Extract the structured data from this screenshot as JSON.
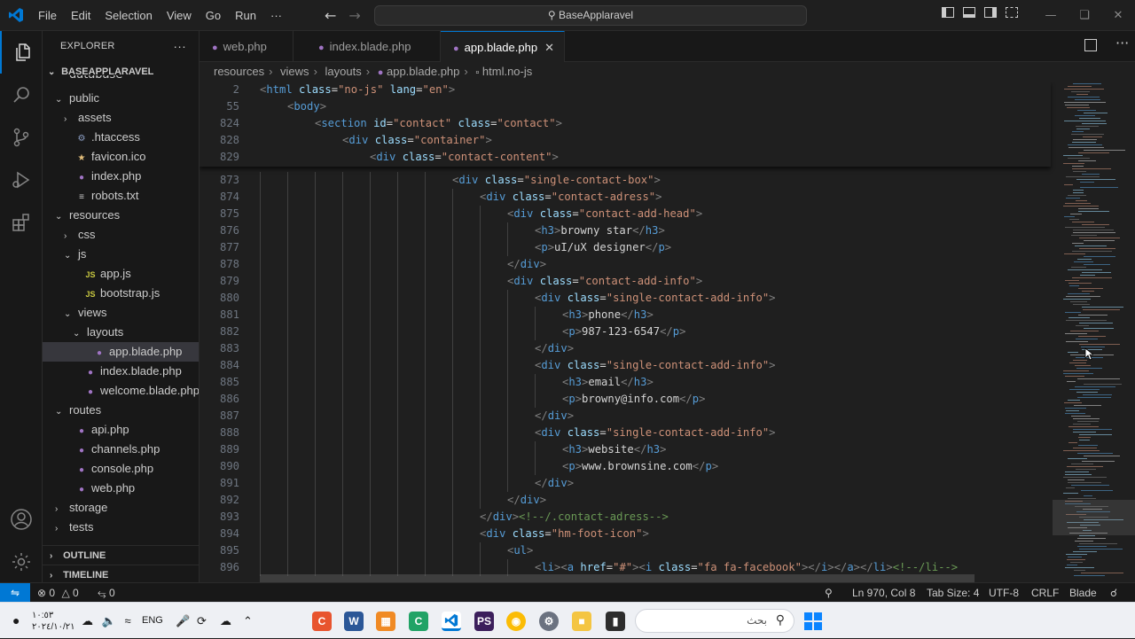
{
  "titlebar": {
    "menu": [
      "File",
      "Edit",
      "Selection",
      "View",
      "Go",
      "Run",
      "···"
    ],
    "command_center": "BaseApplaravel"
  },
  "sidebar": {
    "header": "EXPLORER",
    "project": "BASEAPPLARAVEL",
    "cut_top": "database",
    "items": [
      {
        "label": "public",
        "type": "folder",
        "open": true,
        "depth": 1
      },
      {
        "label": "assets",
        "type": "folder",
        "open": false,
        "depth": 2
      },
      {
        "label": ".htaccess",
        "type": "gear",
        "depth": 2
      },
      {
        "label": "favicon.ico",
        "type": "star",
        "depth": 2
      },
      {
        "label": "index.php",
        "type": "php",
        "depth": 2
      },
      {
        "label": "robots.txt",
        "type": "txt",
        "depth": 2
      },
      {
        "label": "resources",
        "type": "folder",
        "open": true,
        "depth": 1
      },
      {
        "label": "css",
        "type": "folder",
        "open": false,
        "depth": 2
      },
      {
        "label": "js",
        "type": "folder",
        "open": true,
        "depth": 2
      },
      {
        "label": "app.js",
        "type": "js",
        "depth": 3
      },
      {
        "label": "bootstrap.js",
        "type": "js",
        "depth": 3
      },
      {
        "label": "views",
        "type": "folder",
        "open": true,
        "depth": 2
      },
      {
        "label": "layouts",
        "type": "folder",
        "open": true,
        "depth": 3
      },
      {
        "label": "app.blade.php",
        "type": "php",
        "depth": 4,
        "selected": true
      },
      {
        "label": "index.blade.php",
        "type": "php",
        "depth": 3
      },
      {
        "label": "welcome.blade.php",
        "type": "php",
        "depth": 3
      },
      {
        "label": "routes",
        "type": "folder",
        "open": true,
        "depth": 1
      },
      {
        "label": "api.php",
        "type": "php",
        "depth": 2
      },
      {
        "label": "channels.php",
        "type": "php",
        "depth": 2
      },
      {
        "label": "console.php",
        "type": "php",
        "depth": 2
      },
      {
        "label": "web.php",
        "type": "php",
        "depth": 2
      },
      {
        "label": "storage",
        "type": "folder",
        "open": false,
        "depth": 1
      },
      {
        "label": "tests",
        "type": "folder",
        "open": false,
        "depth": 1
      }
    ],
    "outline": "OUTLINE",
    "timeline": "TIMELINE"
  },
  "tabs": [
    {
      "label": "web.php",
      "active": false
    },
    {
      "label": "index.blade.php",
      "active": false
    },
    {
      "label": "app.blade.php",
      "active": true
    }
  ],
  "breadcrumb": [
    "resources",
    "views",
    "layouts",
    "app.blade.php",
    "html.no-js"
  ],
  "sticky_lines": [
    {
      "n": "2",
      "indent": 0,
      "segs": [
        [
          "br",
          "<"
        ],
        [
          "tg",
          "html"
        ],
        [
          "tx",
          " "
        ],
        [
          "at",
          "class"
        ],
        [
          "tx",
          "="
        ],
        [
          "st",
          "\"no-js\""
        ],
        [
          "tx",
          " "
        ],
        [
          "at",
          "lang"
        ],
        [
          "tx",
          "="
        ],
        [
          "st",
          "\"en\""
        ],
        [
          "br",
          ">"
        ]
      ]
    },
    {
      "n": "55",
      "indent": 1,
      "segs": [
        [
          "br",
          "<"
        ],
        [
          "tg",
          "body"
        ],
        [
          "br",
          ">"
        ]
      ]
    },
    {
      "n": "824",
      "indent": 2,
      "segs": [
        [
          "br",
          "<"
        ],
        [
          "tg",
          "section"
        ],
        [
          "tx",
          " "
        ],
        [
          "at",
          "id"
        ],
        [
          "tx",
          "="
        ],
        [
          "st",
          "\"contact\""
        ],
        [
          "tx",
          " "
        ],
        [
          "at",
          "class"
        ],
        [
          "tx",
          "="
        ],
        [
          "st",
          "\"contact\""
        ],
        [
          "br",
          ">"
        ]
      ]
    },
    {
      "n": "828",
      "indent": 3,
      "segs": [
        [
          "br",
          "<"
        ],
        [
          "tg",
          "div"
        ],
        [
          "tx",
          " "
        ],
        [
          "at",
          "class"
        ],
        [
          "tx",
          "="
        ],
        [
          "st",
          "\"container\""
        ],
        [
          "br",
          ">"
        ]
      ]
    },
    {
      "n": "829",
      "indent": 4,
      "segs": [
        [
          "br",
          "<"
        ],
        [
          "tg",
          "div"
        ],
        [
          "tx",
          " "
        ],
        [
          "at",
          "class"
        ],
        [
          "tx",
          "="
        ],
        [
          "st",
          "\"contact-content\""
        ],
        [
          "br",
          ">"
        ]
      ]
    }
  ],
  "code_lines": [
    {
      "n": "873",
      "indent": 7,
      "segs": [
        [
          "br",
          "<"
        ],
        [
          "tg",
          "div"
        ],
        [
          "tx",
          " "
        ],
        [
          "at",
          "class"
        ],
        [
          "tx",
          "="
        ],
        [
          "st",
          "\"single-contact-box\""
        ],
        [
          "br",
          ">"
        ]
      ]
    },
    {
      "n": "874",
      "indent": 8,
      "segs": [
        [
          "br",
          "<"
        ],
        [
          "tg",
          "div"
        ],
        [
          "tx",
          " "
        ],
        [
          "at",
          "class"
        ],
        [
          "tx",
          "="
        ],
        [
          "st",
          "\"contact-adress\""
        ],
        [
          "br",
          ">"
        ]
      ]
    },
    {
      "n": "875",
      "indent": 9,
      "segs": [
        [
          "br",
          "<"
        ],
        [
          "tg",
          "div"
        ],
        [
          "tx",
          " "
        ],
        [
          "at",
          "class"
        ],
        [
          "tx",
          "="
        ],
        [
          "st",
          "\"contact-add-head\""
        ],
        [
          "br",
          ">"
        ]
      ]
    },
    {
      "n": "876",
      "indent": 10,
      "segs": [
        [
          "br",
          "<"
        ],
        [
          "tg",
          "h3"
        ],
        [
          "br",
          ">"
        ],
        [
          "tx",
          "browny star"
        ],
        [
          "br",
          "</"
        ],
        [
          "tg",
          "h3"
        ],
        [
          "br",
          ">"
        ]
      ]
    },
    {
      "n": "877",
      "indent": 10,
      "segs": [
        [
          "br",
          "<"
        ],
        [
          "tg",
          "p"
        ],
        [
          "br",
          ">"
        ],
        [
          "tx",
          "uI/uX designer"
        ],
        [
          "br",
          "</"
        ],
        [
          "tg",
          "p"
        ],
        [
          "br",
          ">"
        ]
      ]
    },
    {
      "n": "878",
      "indent": 9,
      "segs": [
        [
          "br",
          "</"
        ],
        [
          "tg",
          "div"
        ],
        [
          "br",
          ">"
        ]
      ]
    },
    {
      "n": "879",
      "indent": 9,
      "segs": [
        [
          "br",
          "<"
        ],
        [
          "tg",
          "div"
        ],
        [
          "tx",
          " "
        ],
        [
          "at",
          "class"
        ],
        [
          "tx",
          "="
        ],
        [
          "st",
          "\"contact-add-info\""
        ],
        [
          "br",
          ">"
        ]
      ]
    },
    {
      "n": "880",
      "indent": 10,
      "segs": [
        [
          "br",
          "<"
        ],
        [
          "tg",
          "div"
        ],
        [
          "tx",
          " "
        ],
        [
          "at",
          "class"
        ],
        [
          "tx",
          "="
        ],
        [
          "st",
          "\"single-contact-add-info\""
        ],
        [
          "br",
          ">"
        ]
      ]
    },
    {
      "n": "881",
      "indent": 11,
      "segs": [
        [
          "br",
          "<"
        ],
        [
          "tg",
          "h3"
        ],
        [
          "br",
          ">"
        ],
        [
          "tx",
          "phone"
        ],
        [
          "br",
          "</"
        ],
        [
          "tg",
          "h3"
        ],
        [
          "br",
          ">"
        ]
      ]
    },
    {
      "n": "882",
      "indent": 11,
      "segs": [
        [
          "br",
          "<"
        ],
        [
          "tg",
          "p"
        ],
        [
          "br",
          ">"
        ],
        [
          "tx",
          "987-123-6547"
        ],
        [
          "br",
          "</"
        ],
        [
          "tg",
          "p"
        ],
        [
          "br",
          ">"
        ]
      ]
    },
    {
      "n": "883",
      "indent": 10,
      "segs": [
        [
          "br",
          "</"
        ],
        [
          "tg",
          "div"
        ],
        [
          "br",
          ">"
        ]
      ]
    },
    {
      "n": "884",
      "indent": 10,
      "segs": [
        [
          "br",
          "<"
        ],
        [
          "tg",
          "div"
        ],
        [
          "tx",
          " "
        ],
        [
          "at",
          "class"
        ],
        [
          "tx",
          "="
        ],
        [
          "st",
          "\"single-contact-add-info\""
        ],
        [
          "br",
          ">"
        ]
      ]
    },
    {
      "n": "885",
      "indent": 11,
      "segs": [
        [
          "br",
          "<"
        ],
        [
          "tg",
          "h3"
        ],
        [
          "br",
          ">"
        ],
        [
          "tx",
          "email"
        ],
        [
          "br",
          "</"
        ],
        [
          "tg",
          "h3"
        ],
        [
          "br",
          ">"
        ]
      ]
    },
    {
      "n": "886",
      "indent": 11,
      "segs": [
        [
          "br",
          "<"
        ],
        [
          "tg",
          "p"
        ],
        [
          "br",
          ">"
        ],
        [
          "tx",
          "browny@info.com"
        ],
        [
          "br",
          "</"
        ],
        [
          "tg",
          "p"
        ],
        [
          "br",
          ">"
        ]
      ]
    },
    {
      "n": "887",
      "indent": 10,
      "segs": [
        [
          "br",
          "</"
        ],
        [
          "tg",
          "div"
        ],
        [
          "br",
          ">"
        ]
      ]
    },
    {
      "n": "888",
      "indent": 10,
      "segs": [
        [
          "br",
          "<"
        ],
        [
          "tg",
          "div"
        ],
        [
          "tx",
          " "
        ],
        [
          "at",
          "class"
        ],
        [
          "tx",
          "="
        ],
        [
          "st",
          "\"single-contact-add-info\""
        ],
        [
          "br",
          ">"
        ]
      ]
    },
    {
      "n": "889",
      "indent": 11,
      "segs": [
        [
          "br",
          "<"
        ],
        [
          "tg",
          "h3"
        ],
        [
          "br",
          ">"
        ],
        [
          "tx",
          "website"
        ],
        [
          "br",
          "</"
        ],
        [
          "tg",
          "h3"
        ],
        [
          "br",
          ">"
        ]
      ]
    },
    {
      "n": "890",
      "indent": 11,
      "segs": [
        [
          "br",
          "<"
        ],
        [
          "tg",
          "p"
        ],
        [
          "br",
          ">"
        ],
        [
          "tx",
          "www.brownsine.com"
        ],
        [
          "br",
          "</"
        ],
        [
          "tg",
          "p"
        ],
        [
          "br",
          ">"
        ]
      ]
    },
    {
      "n": "891",
      "indent": 10,
      "segs": [
        [
          "br",
          "</"
        ],
        [
          "tg",
          "div"
        ],
        [
          "br",
          ">"
        ]
      ]
    },
    {
      "n": "892",
      "indent": 9,
      "segs": [
        [
          "br",
          "</"
        ],
        [
          "tg",
          "div"
        ],
        [
          "br",
          ">"
        ]
      ]
    },
    {
      "n": "893",
      "indent": 8,
      "segs": [
        [
          "br",
          "</"
        ],
        [
          "tg",
          "div"
        ],
        [
          "br",
          ">"
        ],
        [
          "cm",
          "<!--/.contact-adress-->"
        ]
      ]
    },
    {
      "n": "894",
      "indent": 8,
      "segs": [
        [
          "br",
          "<"
        ],
        [
          "tg",
          "div"
        ],
        [
          "tx",
          " "
        ],
        [
          "at",
          "class"
        ],
        [
          "tx",
          "="
        ],
        [
          "st",
          "\"hm-foot-icon\""
        ],
        [
          "br",
          ">"
        ]
      ]
    },
    {
      "n": "895",
      "indent": 9,
      "segs": [
        [
          "br",
          "<"
        ],
        [
          "tg",
          "ul"
        ],
        [
          "br",
          ">"
        ]
      ]
    },
    {
      "n": "896",
      "indent": 10,
      "segs": [
        [
          "br",
          "<"
        ],
        [
          "tg",
          "li"
        ],
        [
          "br",
          "><"
        ],
        [
          "tg",
          "a"
        ],
        [
          "tx",
          " "
        ],
        [
          "at",
          "href"
        ],
        [
          "tx",
          "="
        ],
        [
          "st",
          "\"#\""
        ],
        [
          "br",
          "><"
        ],
        [
          "tg",
          "i"
        ],
        [
          "tx",
          " "
        ],
        [
          "at",
          "class"
        ],
        [
          "tx",
          "="
        ],
        [
          "st",
          "\"fa fa-facebook\""
        ],
        [
          "br",
          "></"
        ],
        [
          "tg",
          "i"
        ],
        [
          "br",
          "></"
        ],
        [
          "tg",
          "a"
        ],
        [
          "br",
          "></"
        ],
        [
          "tg",
          "li"
        ],
        [
          "br",
          ">"
        ],
        [
          "cm",
          "<!--/li-->"
        ]
      ]
    }
  ],
  "statusbar": {
    "errors": "0",
    "warnings": "0",
    "ports": "0",
    "position": "Ln 970, Col 8",
    "tab_size": "Tab Size: 4",
    "encoding": "UTF-8",
    "eol": "CRLF",
    "language": "Blade"
  },
  "taskbar": {
    "clock_time": "١٠:٥٣",
    "clock_date": "٢٠٢٤/١٠/٢١",
    "lang": "ENG",
    "search_placeholder": "بحث"
  },
  "colors": {
    "accent": "#0078d4",
    "tag": "#569cd6",
    "attribute": "#9cdcfe",
    "string": "#ce9178",
    "comment": "#6a9955",
    "php_icon": "#a074c4",
    "js_icon": "#cbcb41"
  }
}
